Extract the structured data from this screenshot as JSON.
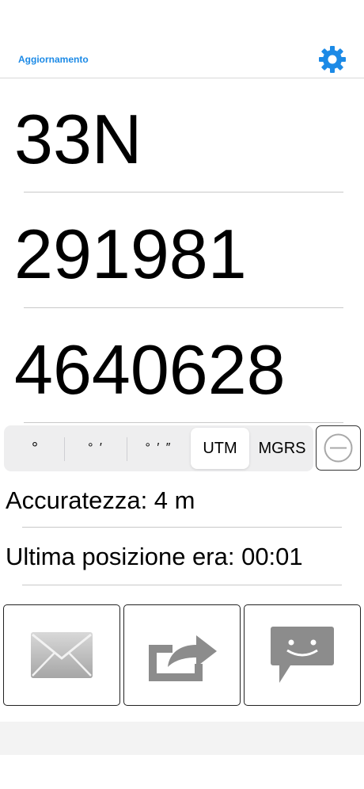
{
  "header": {
    "refresh_label": "Aggiornamento",
    "settings_icon": "gear-icon",
    "accent_color": "#1c8ae6"
  },
  "coordinates": {
    "zone": "33N",
    "easting": "291981",
    "northing": "4640628"
  },
  "format_selector": {
    "options": [
      "°",
      "° ′",
      "° ′ ″",
      "UTM",
      "MGRS"
    ],
    "selected": "UTM",
    "remove_icon": "minus-circle-icon"
  },
  "status": {
    "accuracy": "Accuratezza: 4 m",
    "last_position": "Ultima posizione era: 00:01"
  },
  "actions": [
    {
      "icon": "envelope-icon"
    },
    {
      "icon": "share-icon"
    },
    {
      "icon": "message-icon"
    }
  ]
}
